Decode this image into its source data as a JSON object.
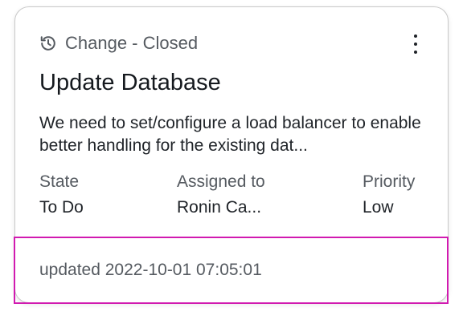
{
  "card": {
    "record_type": "Change - Closed",
    "type_icon": "history-icon",
    "menu_icon": "more-vertical-icon",
    "title": "Update Database",
    "description": "We need to set/configure a load balancer to enable better handling for the existing dat...",
    "fields": {
      "state": {
        "label": "State",
        "value": "To Do"
      },
      "assigned_to": {
        "label": "Assigned to",
        "value": "Ronin Ca..."
      },
      "priority": {
        "label": "Priority",
        "value": "Low"
      }
    },
    "footer": {
      "updated": "updated 2022-10-01 07:05:01"
    }
  },
  "colors": {
    "highlight_border": "#d11ab0",
    "muted_text": "#555a60",
    "primary_text": "#15191e"
  }
}
